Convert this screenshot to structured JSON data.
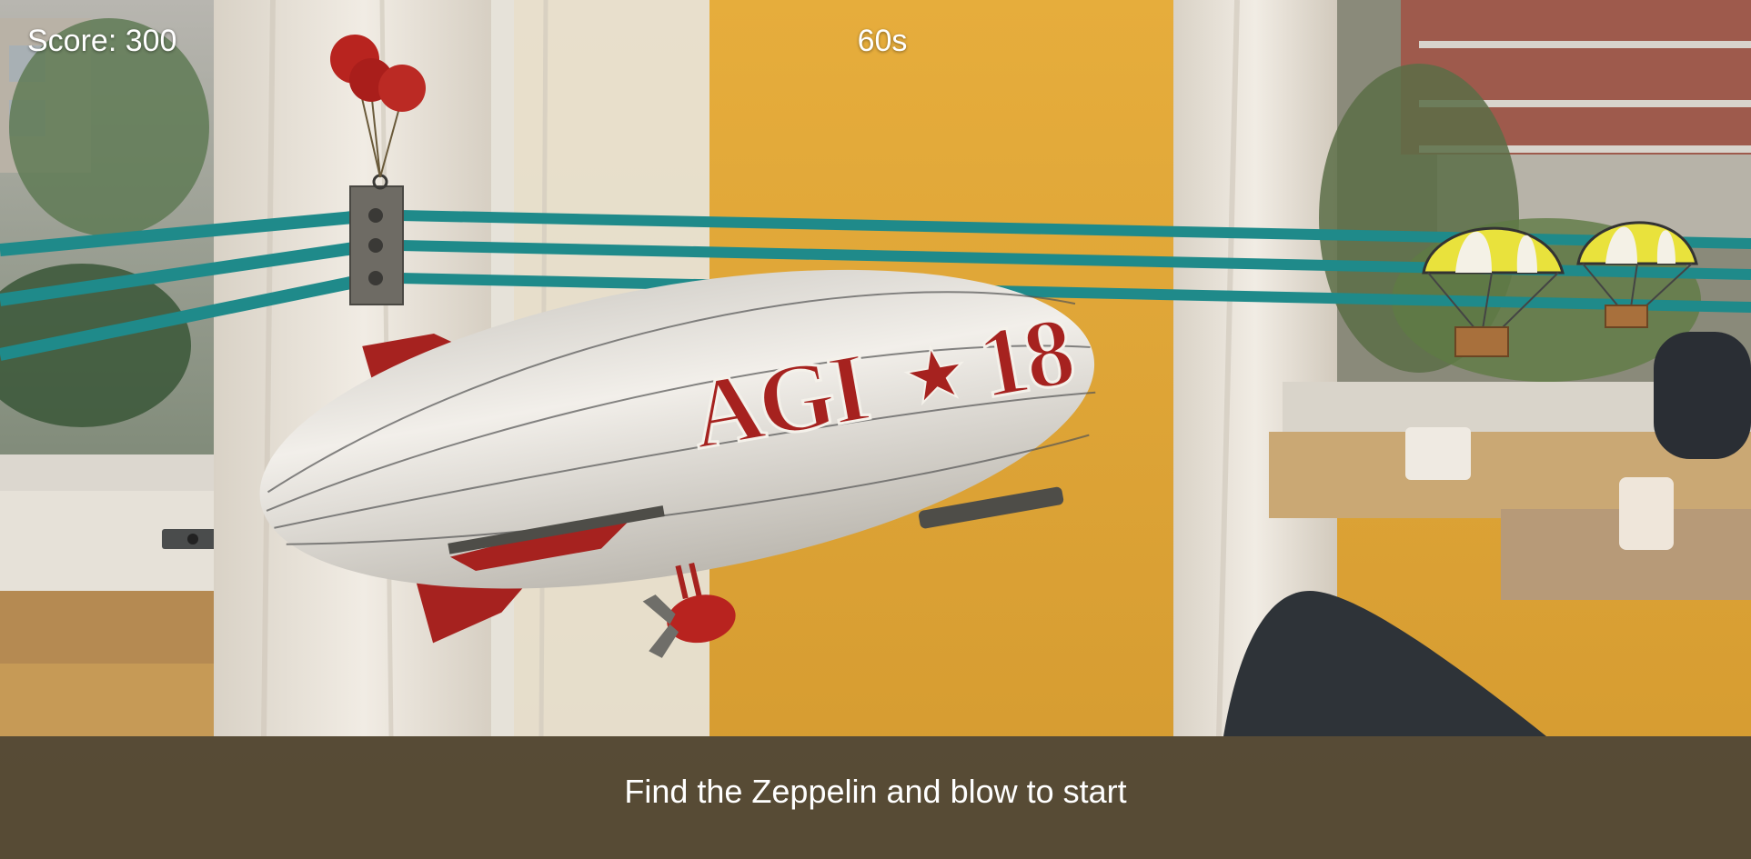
{
  "hud": {
    "score": "Score: 300",
    "timer": "60s"
  },
  "prompt": {
    "instruction": "Find the Zeppelin and blow to start"
  },
  "zeppelin": {
    "label": "AGI☘18",
    "label_left": "AGI",
    "label_right": "18"
  },
  "colors": {
    "wall": "#e1a838",
    "curtain": "#e8e2d8",
    "rope": "#1f8a8a",
    "zeppelin_body": "#e9e6e0",
    "zeppelin_fin": "#a6221f",
    "parachute_yellow": "#e9e23c",
    "crate": "#a8703c"
  }
}
